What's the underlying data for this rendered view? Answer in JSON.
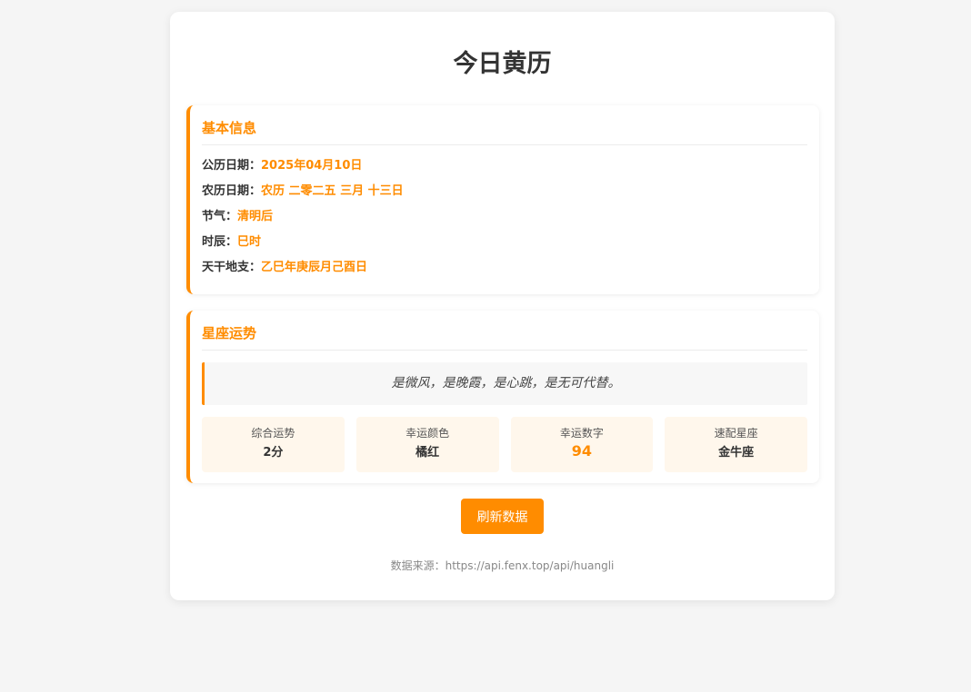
{
  "title": "今日黄历",
  "basic": {
    "heading": "基本信息",
    "rows": [
      {
        "label": "公历日期：",
        "value": "2025年04月10日"
      },
      {
        "label": "农历日期：",
        "value": "农历 二零二五 三月 十三日"
      },
      {
        "label": "节气：",
        "value": "清明后"
      },
      {
        "label": "时辰：",
        "value": "巳时"
      },
      {
        "label": "天干地支：",
        "value": "乙巳年庚辰月己酉日"
      }
    ]
  },
  "horoscope": {
    "heading": "星座运势",
    "quote": "是微风，是晚霞，是心跳，是无可代替。",
    "stats": [
      {
        "label": "综合运势",
        "value": "2分"
      },
      {
        "label": "幸运颜色",
        "value": "橘红"
      },
      {
        "label": "幸运数字",
        "value": "94"
      },
      {
        "label": "速配星座",
        "value": "金牛座"
      }
    ]
  },
  "refresh_label": "刷新数据",
  "footer": "数据来源：https://api.fenx.top/api/huangli",
  "colors": {
    "accent": "#ff8c00",
    "page_bg": "#f5f5f5",
    "stat_bg": "#fff7ec"
  }
}
